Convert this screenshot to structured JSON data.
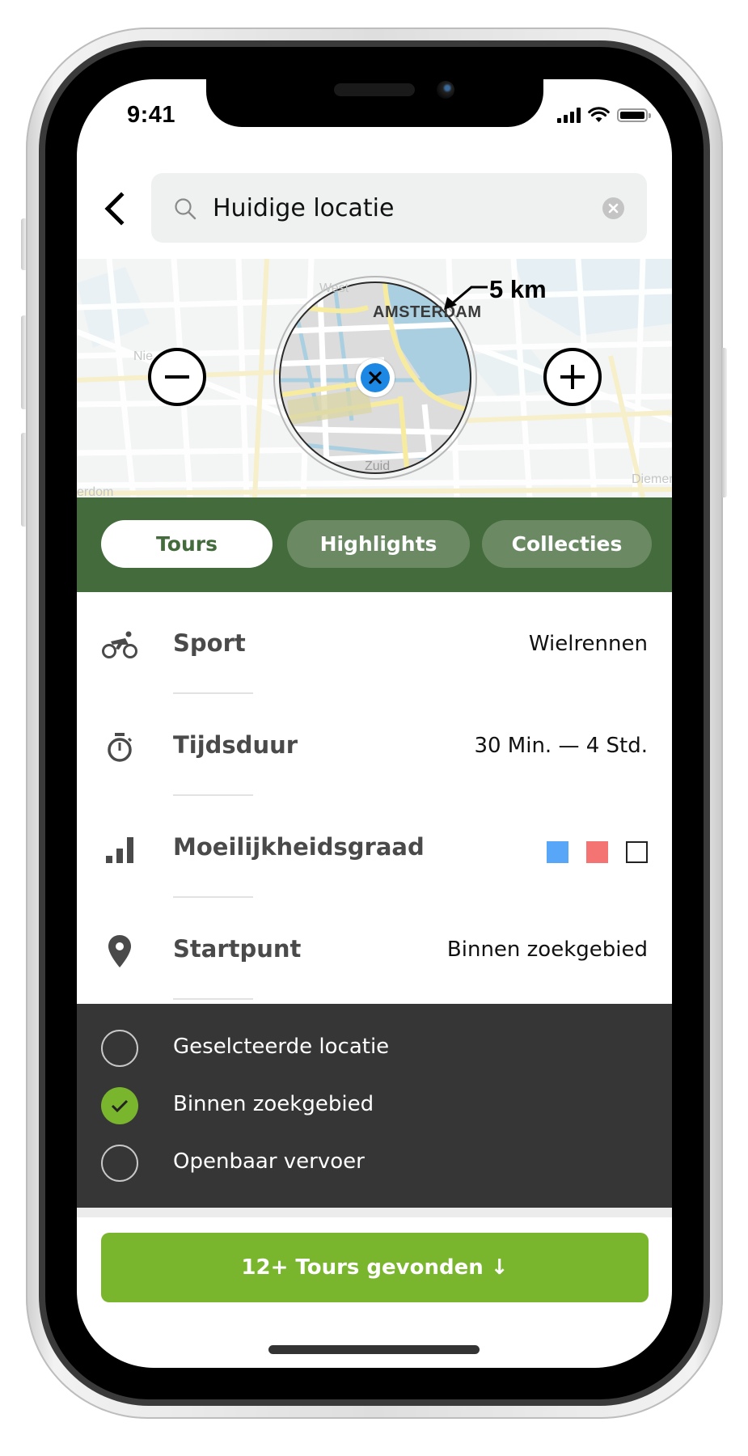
{
  "status_bar": {
    "time": "9:41",
    "icons": [
      "cellular-signal-icon",
      "wifi-icon",
      "battery-icon"
    ]
  },
  "header": {
    "back_icon": "chevron-left-icon",
    "search": {
      "icon": "search-icon",
      "value": "Huidige locatie",
      "placeholder": "",
      "clear_icon": "clear-circle-icon"
    }
  },
  "map": {
    "labels": {
      "city": "AMSTERDAM",
      "district_south": "Zuid",
      "district_west": "West",
      "district_newwest": "Nie",
      "town_east": "Diemen",
      "area_sw": "erdom"
    },
    "radius_label": "5 km",
    "zoom_out_icon": "minus-icon",
    "zoom_in_icon": "plus-icon",
    "center_pin_icon": "location-pin-x-icon"
  },
  "tabs": [
    {
      "label": "Tours",
      "active": true
    },
    {
      "label": "Highlights",
      "active": false
    },
    {
      "label": "Collecties",
      "active": false
    }
  ],
  "filters": [
    {
      "icon": "road-bike-icon",
      "label": "Sport",
      "value": "Wielrennen"
    },
    {
      "icon": "stopwatch-icon",
      "label": "Tijdsduur",
      "value": "30 Min. — 4 Std."
    },
    {
      "icon": "difficulty-bars-icon",
      "label": "Moeilijkheidsgraad",
      "value": "",
      "levels": [
        {
          "name": "easy",
          "color": "#58a6f7",
          "selected": true
        },
        {
          "name": "moderate",
          "color": "#f47474",
          "selected": true
        },
        {
          "name": "difficult",
          "color": "#ffffff",
          "selected": false
        }
      ]
    },
    {
      "icon": "map-pin-icon",
      "label": "Startpunt",
      "value": "Binnen zoekgebied"
    }
  ],
  "startpoint_options": [
    {
      "label": "Geselcteerde locatie",
      "checked": false
    },
    {
      "label": "Binnen zoekgebied",
      "checked": true
    },
    {
      "label": "Openbaar vervoer",
      "checked": false
    }
  ],
  "cta": {
    "label": "12+ Tours gevonden ↓"
  },
  "colors": {
    "brand_green": "#436b3c",
    "tab_inactive": "#6b8a64",
    "accent_green": "#7ab52e",
    "options_bg": "#363636"
  }
}
